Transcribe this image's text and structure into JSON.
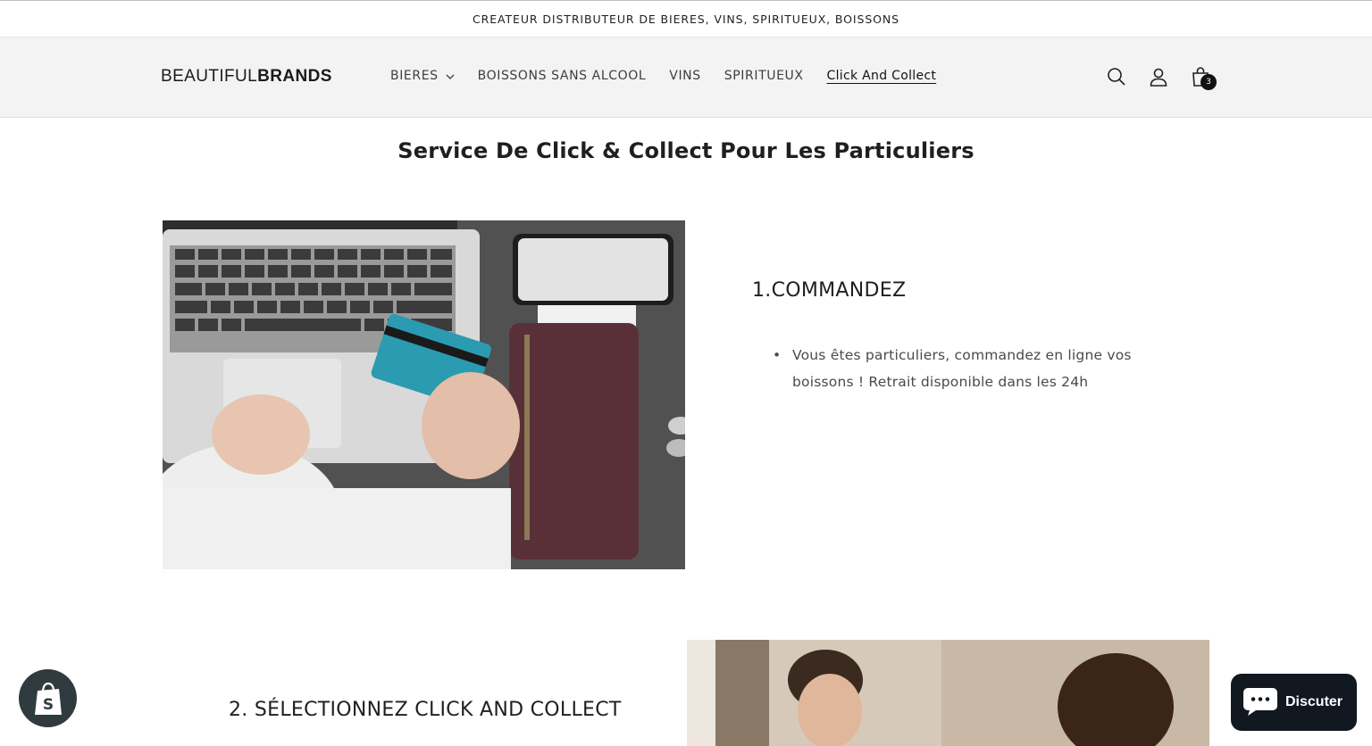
{
  "announcement": {
    "text": "CREATEUR DISTRIBUTEUR DE BIERES, VINS, SPIRITUEUX, BOISSONS"
  },
  "header": {
    "logo_light": "BEAUTIFUL",
    "logo_bold": "BRANDS",
    "nav": [
      {
        "label": "BIERES",
        "has_dropdown": true
      },
      {
        "label": "BOISSONS SANS ALCOOL"
      },
      {
        "label": "VINS"
      },
      {
        "label": "SPIRITUEUX"
      },
      {
        "label": "Click And Collect",
        "active": true
      }
    ],
    "icons": [
      "search-icon",
      "account-icon",
      "cart-icon"
    ],
    "cart_count": "3"
  },
  "main": {
    "title": "Service De Click & Collect Pour Les Particuliers",
    "step1": {
      "title": "1.COMMANDEZ",
      "bullets": [
        "Vous êtes particuliers, commandez en ligne vos boissons ! Retrait disponible dans les 24h"
      ]
    },
    "step2": {
      "title": "2. SÉLECTIONNEZ CLICK AND COLLECT"
    }
  },
  "widgets": {
    "chat_label": "Discuter",
    "shopify_icon": "shopify-bag-icon"
  },
  "colors": {
    "header_bg": "#f3f3f3",
    "text": "#121212",
    "chat_bg": "#111820"
  }
}
